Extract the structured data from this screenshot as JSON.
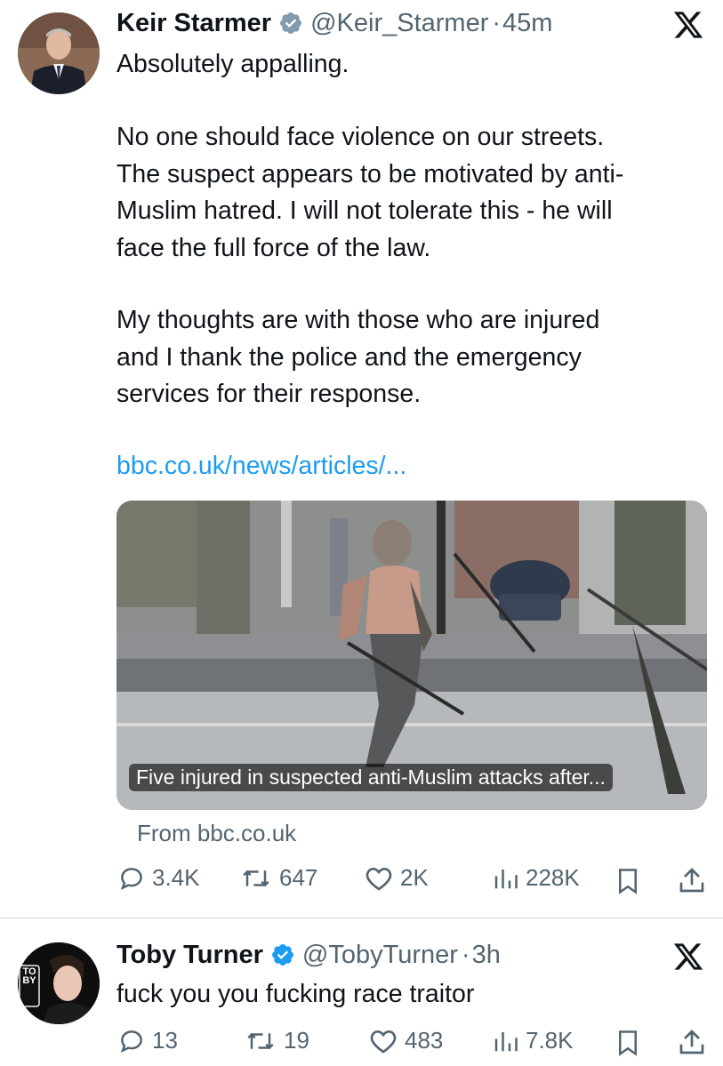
{
  "tweets": [
    {
      "author_name": "Keir Starmer",
      "handle": "@Keir_Starmer",
      "separator": "·",
      "time": "45m",
      "text_1": "Absolutely appalling.",
      "text_2": "No one should face violence on our streets.\nThe suspect appears to be motivated by anti-\nMuslim hatred. I will not tolerate this - he will\nface the full force of the law.",
      "text_3": "My thoughts are with those who are injured\nand I thank the police and the emergency\nservices for their response.",
      "link": "bbc.co.uk/news/articles/...",
      "card_caption": "Five injured in suspected anti-Muslim attacks after...",
      "card_source": "From bbc.co.uk",
      "replies": "3.4K",
      "reposts": "647",
      "likes": "2K",
      "views": "228K"
    },
    {
      "author_name": "Toby Turner",
      "handle": "@TobyTurner",
      "separator": "·",
      "time": "3h",
      "text_1": "fuck you you fucking race traitor",
      "avatar_text": "TOBY",
      "replies": "13",
      "reposts": "19",
      "likes": "483",
      "views": "7.8K"
    }
  ],
  "colors": {
    "verified": "#829aab",
    "link": "#1d9bf0",
    "muted": "#536471",
    "divider": "#cfd9de"
  },
  "icons": [
    "verified-badge-icon",
    "x-logo-icon",
    "reply-icon",
    "repost-icon",
    "like-icon",
    "views-icon",
    "bookmark-icon",
    "share-icon"
  ]
}
